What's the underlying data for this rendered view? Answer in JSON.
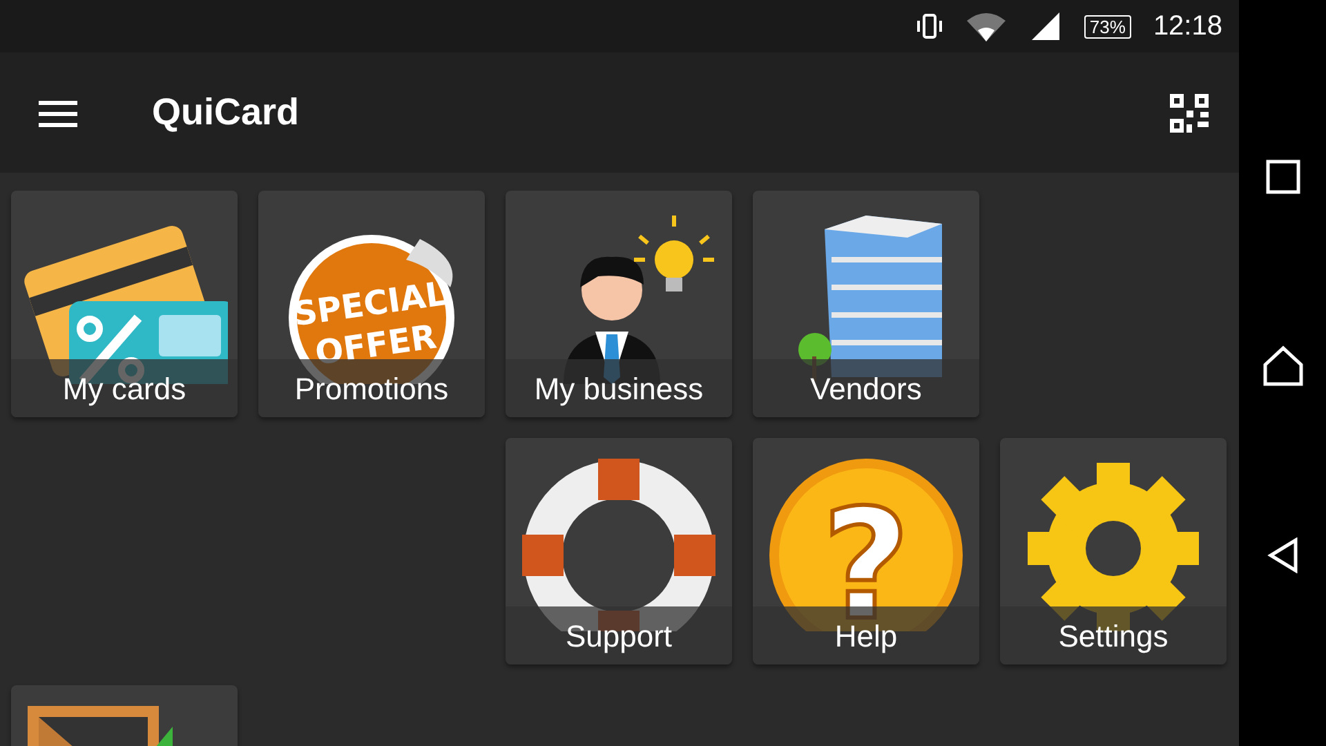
{
  "status_bar": {
    "battery": "73%",
    "time": "12:18"
  },
  "app_bar": {
    "title": "QuiCard"
  },
  "grid": {
    "rows": [
      {
        "cells": [
          {
            "kind": "cards",
            "label": "My cards"
          },
          {
            "kind": "offer",
            "label": "Promotions",
            "art_text": [
              "SPECIAL",
              "OFFER"
            ]
          },
          {
            "kind": "business",
            "label": "My business"
          },
          {
            "kind": "building",
            "label": "Vendors"
          },
          {
            "kind": "blank"
          }
        ]
      },
      {
        "cells": [
          {
            "kind": "blank"
          },
          {
            "kind": "blank"
          },
          {
            "kind": "lifebuoy",
            "label": "Support"
          },
          {
            "kind": "help",
            "label": "Help",
            "art_text": [
              "?"
            ]
          },
          {
            "kind": "gear",
            "label": "Settings"
          }
        ]
      },
      {
        "cells": [
          {
            "kind": "door"
          }
        ]
      }
    ]
  }
}
